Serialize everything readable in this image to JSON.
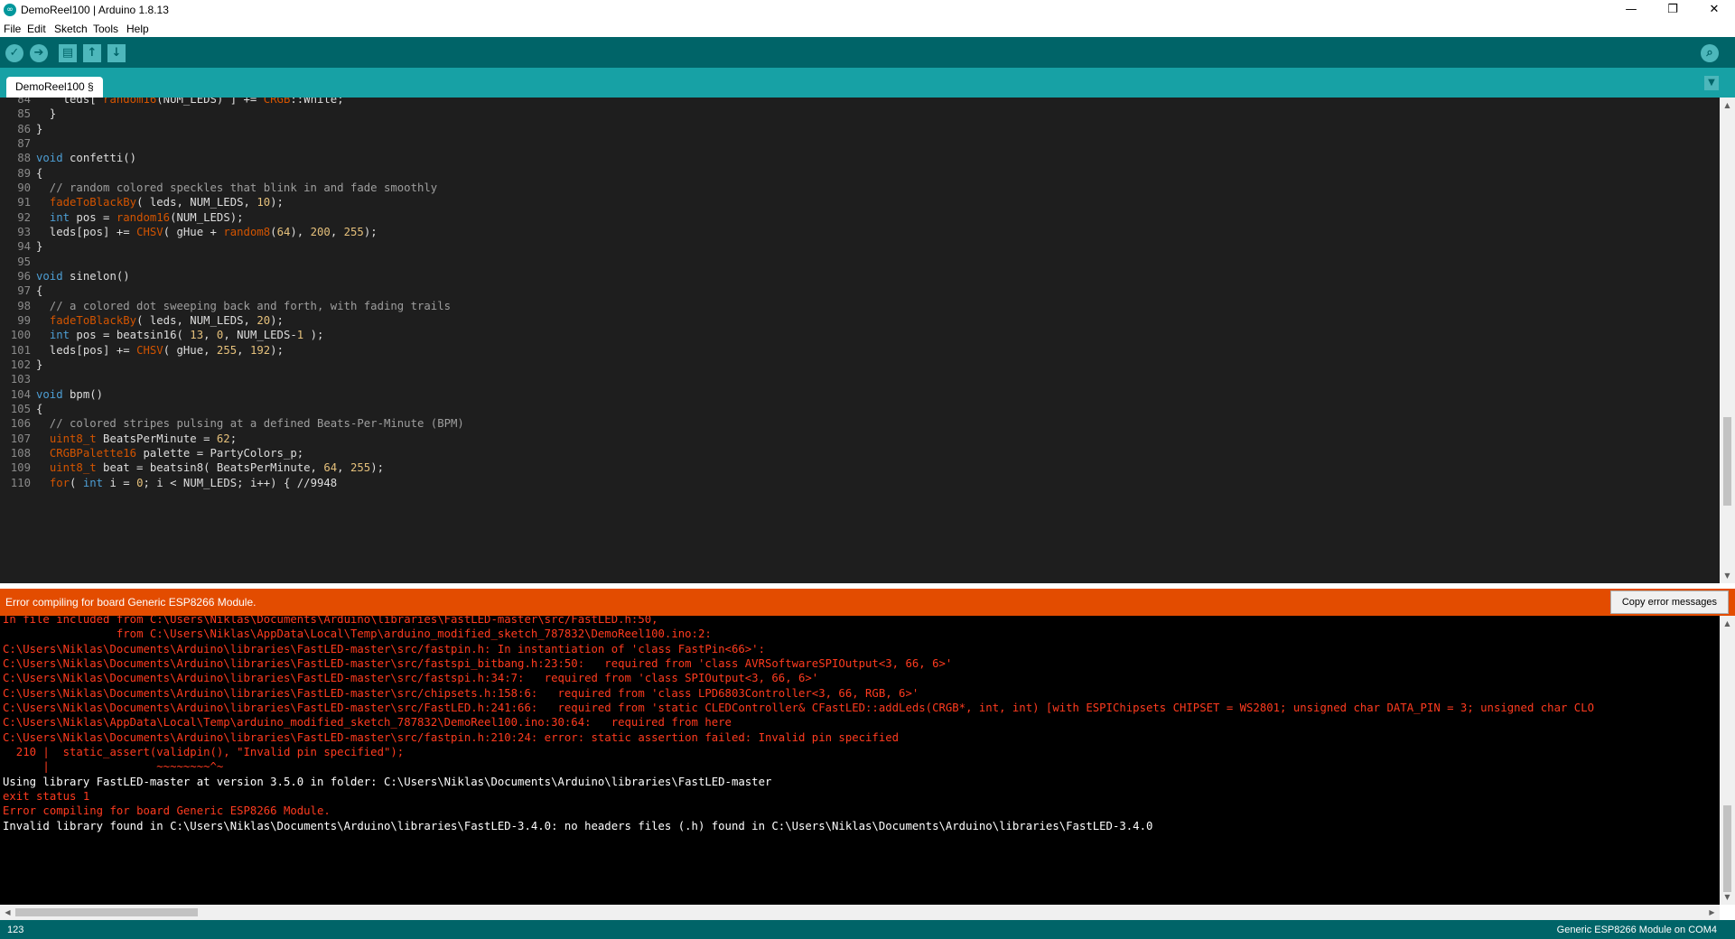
{
  "window": {
    "title": "DemoReel100 | Arduino 1.8.13",
    "minimize": "—",
    "restore": "❐",
    "close": "✕"
  },
  "menu": [
    "File",
    "Edit",
    "Sketch",
    "Tools",
    "Help"
  ],
  "toolbar": {
    "verify_icon": "✓",
    "upload_icon": "➔",
    "new_icon": "▤",
    "open_icon": "↑",
    "save_icon": "↓",
    "serial_icon": "⌕"
  },
  "tab": {
    "label": "DemoReel100 §",
    "menu_icon": "▼"
  },
  "colors": {
    "keyword": "#4d9ed4",
    "function": "#d35400",
    "number": "#e5c07b",
    "comment": "#9e9e9e",
    "text": "#dddddd",
    "error_text": "#ff3b1f",
    "white_text": "#ffffff",
    "status_bar": "#e34c00",
    "toolbar": "#006468",
    "tabbar": "#17a1a5"
  },
  "code_lines": [
    {
      "num": "84",
      "segs": [
        {
          "t": "    leds[ ",
          "c": "t"
        },
        {
          "t": "random16",
          "c": "f"
        },
        {
          "t": "(NUM_LEDS) ] += ",
          "c": "t"
        },
        {
          "t": "CRGB",
          "c": "f"
        },
        {
          "t": "::White;",
          "c": "t"
        }
      ]
    },
    {
      "num": "85",
      "segs": [
        {
          "t": "  }",
          "c": "t"
        }
      ]
    },
    {
      "num": "86",
      "segs": [
        {
          "t": "}",
          "c": "t"
        }
      ]
    },
    {
      "num": "87",
      "segs": []
    },
    {
      "num": "88",
      "segs": [
        {
          "t": "void",
          "c": "k"
        },
        {
          "t": " confetti()",
          "c": "t"
        }
      ]
    },
    {
      "num": "89",
      "segs": [
        {
          "t": "{",
          "c": "t"
        }
      ]
    },
    {
      "num": "90",
      "segs": [
        {
          "t": "  // random colored speckles that blink in and fade smoothly",
          "c": "c"
        }
      ]
    },
    {
      "num": "91",
      "segs": [
        {
          "t": "  ",
          "c": "t"
        },
        {
          "t": "fadeToBlackBy",
          "c": "f"
        },
        {
          "t": "( leds, NUM_LEDS, ",
          "c": "t"
        },
        {
          "t": "10",
          "c": "n"
        },
        {
          "t": ");",
          "c": "t"
        }
      ]
    },
    {
      "num": "92",
      "segs": [
        {
          "t": "  ",
          "c": "t"
        },
        {
          "t": "int",
          "c": "k"
        },
        {
          "t": " pos = ",
          "c": "t"
        },
        {
          "t": "random16",
          "c": "f"
        },
        {
          "t": "(NUM_LEDS);",
          "c": "t"
        }
      ]
    },
    {
      "num": "93",
      "segs": [
        {
          "t": "  leds[pos] += ",
          "c": "t"
        },
        {
          "t": "CHSV",
          "c": "f"
        },
        {
          "t": "( gHue + ",
          "c": "t"
        },
        {
          "t": "random8",
          "c": "f"
        },
        {
          "t": "(",
          "c": "t"
        },
        {
          "t": "64",
          "c": "n"
        },
        {
          "t": "), ",
          "c": "t"
        },
        {
          "t": "200",
          "c": "n"
        },
        {
          "t": ", ",
          "c": "t"
        },
        {
          "t": "255",
          "c": "n"
        },
        {
          "t": ");",
          "c": "t"
        }
      ]
    },
    {
      "num": "94",
      "segs": [
        {
          "t": "}",
          "c": "t"
        }
      ]
    },
    {
      "num": "95",
      "segs": []
    },
    {
      "num": "96",
      "segs": [
        {
          "t": "void",
          "c": "k"
        },
        {
          "t": " sinelon()",
          "c": "t"
        }
      ]
    },
    {
      "num": "97",
      "segs": [
        {
          "t": "{",
          "c": "t"
        }
      ]
    },
    {
      "num": "98",
      "segs": [
        {
          "t": "  // a colored dot sweeping back and forth, with fading trails",
          "c": "c"
        }
      ]
    },
    {
      "num": "99",
      "segs": [
        {
          "t": "  ",
          "c": "t"
        },
        {
          "t": "fadeToBlackBy",
          "c": "f"
        },
        {
          "t": "( leds, NUM_LEDS, ",
          "c": "t"
        },
        {
          "t": "20",
          "c": "n"
        },
        {
          "t": ");",
          "c": "t"
        }
      ]
    },
    {
      "num": "100",
      "segs": [
        {
          "t": "  ",
          "c": "t"
        },
        {
          "t": "int",
          "c": "k"
        },
        {
          "t": " pos = beatsin16( ",
          "c": "t"
        },
        {
          "t": "13",
          "c": "n"
        },
        {
          "t": ", ",
          "c": "t"
        },
        {
          "t": "0",
          "c": "n"
        },
        {
          "t": ", NUM_LEDS-",
          "c": "t"
        },
        {
          "t": "1",
          "c": "n"
        },
        {
          "t": " );",
          "c": "t"
        }
      ]
    },
    {
      "num": "101",
      "segs": [
        {
          "t": "  leds[pos] += ",
          "c": "t"
        },
        {
          "t": "CHSV",
          "c": "f"
        },
        {
          "t": "( gHue, ",
          "c": "t"
        },
        {
          "t": "255",
          "c": "n"
        },
        {
          "t": ", ",
          "c": "t"
        },
        {
          "t": "192",
          "c": "n"
        },
        {
          "t": ");",
          "c": "t"
        }
      ]
    },
    {
      "num": "102",
      "segs": [
        {
          "t": "}",
          "c": "t"
        }
      ]
    },
    {
      "num": "103",
      "segs": []
    },
    {
      "num": "104",
      "segs": [
        {
          "t": "void",
          "c": "k"
        },
        {
          "t": " bpm()",
          "c": "t"
        }
      ]
    },
    {
      "num": "105",
      "segs": [
        {
          "t": "{",
          "c": "t"
        }
      ]
    },
    {
      "num": "106",
      "segs": [
        {
          "t": "  // colored stripes pulsing at a defined Beats-Per-Minute (BPM)",
          "c": "c"
        }
      ]
    },
    {
      "num": "107",
      "segs": [
        {
          "t": "  ",
          "c": "t"
        },
        {
          "t": "uint8_t",
          "c": "f"
        },
        {
          "t": " BeatsPerMinute = ",
          "c": "t"
        },
        {
          "t": "62",
          "c": "n"
        },
        {
          "t": ";",
          "c": "t"
        }
      ]
    },
    {
      "num": "108",
      "segs": [
        {
          "t": "  ",
          "c": "t"
        },
        {
          "t": "CRGBPalette16",
          "c": "f"
        },
        {
          "t": " palette = PartyColors_p;",
          "c": "t"
        }
      ]
    },
    {
      "num": "109",
      "segs": [
        {
          "t": "  ",
          "c": "t"
        },
        {
          "t": "uint8_t",
          "c": "f"
        },
        {
          "t": " beat = beatsin8( BeatsPerMinute, ",
          "c": "t"
        },
        {
          "t": "64",
          "c": "n"
        },
        {
          "t": ", ",
          "c": "t"
        },
        {
          "t": "255",
          "c": "n"
        },
        {
          "t": ");",
          "c": "t"
        }
      ]
    },
    {
      "num": "110",
      "segs": [
        {
          "t": "  ",
          "c": "t"
        },
        {
          "t": "for",
          "c": "f"
        },
        {
          "t": "( ",
          "c": "t"
        },
        {
          "t": "int",
          "c": "k"
        },
        {
          "t": " i = ",
          "c": "t"
        },
        {
          "t": "0",
          "c": "n"
        },
        {
          "t": "; i < NUM_LEDS; i++) { //9948",
          "c": "t"
        }
      ]
    }
  ],
  "status": {
    "message": "Error compiling for board Generic ESP8266 Module.",
    "copy_button": "Copy error messages"
  },
  "console_lines": [
    {
      "text": "In file included from C:\\Users\\Niklas\\Documents\\Arduino\\libraries\\FastLED-master\\src/FastLED.h:50,",
      "c": "e"
    },
    {
      "text": "                 from C:\\Users\\Niklas\\AppData\\Local\\Temp\\arduino_modified_sketch_787832\\DemoReel100.ino:2:",
      "c": "e"
    },
    {
      "text": "C:\\Users\\Niklas\\Documents\\Arduino\\libraries\\FastLED-master\\src/fastpin.h: In instantiation of 'class FastPin<66>':",
      "c": "e"
    },
    {
      "text": "C:\\Users\\Niklas\\Documents\\Arduino\\libraries\\FastLED-master\\src/fastspi_bitbang.h:23:50:   required from 'class AVRSoftwareSPIOutput<3, 66, 6>'",
      "c": "e"
    },
    {
      "text": "C:\\Users\\Niklas\\Documents\\Arduino\\libraries\\FastLED-master\\src/fastspi.h:34:7:   required from 'class SPIOutput<3, 66, 6>'",
      "c": "e"
    },
    {
      "text": "C:\\Users\\Niklas\\Documents\\Arduino\\libraries\\FastLED-master\\src/chipsets.h:158:6:   required from 'class LPD6803Controller<3, 66, RGB, 6>'",
      "c": "e"
    },
    {
      "text": "C:\\Users\\Niklas\\Documents\\Arduino\\libraries\\FastLED-master\\src/FastLED.h:241:66:   required from 'static CLEDController& CFastLED::addLeds(CRGB*, int, int) [with ESPIChipsets CHIPSET = WS2801; unsigned char DATA_PIN = 3; unsigned char CLO",
      "c": "e"
    },
    {
      "text": "C:\\Users\\Niklas\\AppData\\Local\\Temp\\arduino_modified_sketch_787832\\DemoReel100.ino:30:64:   required from here",
      "c": "e"
    },
    {
      "text": "C:\\Users\\Niklas\\Documents\\Arduino\\libraries\\FastLED-master\\src/fastpin.h:210:24: error: static assertion failed: Invalid pin specified",
      "c": "e"
    },
    {
      "text": "  210 |  static_assert(validpin(), \"Invalid pin specified\");",
      "c": "e"
    },
    {
      "text": "      |                ~~~~~~~~^~",
      "c": "e"
    },
    {
      "text": "Using library FastLED-master at version 3.5.0 in folder: C:\\Users\\Niklas\\Documents\\Arduino\\libraries\\FastLED-master",
      "c": "w"
    },
    {
      "text": "exit status 1",
      "c": "e"
    },
    {
      "text": "Error compiling for board Generic ESP8266 Module.",
      "c": "e"
    },
    {
      "text": "Invalid library found in C:\\Users\\Niklas\\Documents\\Arduino\\libraries\\FastLED-3.4.0: no headers files (.h) found in C:\\Users\\Niklas\\Documents\\Arduino\\libraries\\FastLED-3.4.0",
      "c": "w"
    }
  ],
  "footer": {
    "line_number": "123",
    "board": "Generic ESP8266 Module on COM4"
  },
  "scroll_arrows": {
    "up": "▲",
    "down": "▼",
    "left": "◀",
    "right": "▶"
  }
}
